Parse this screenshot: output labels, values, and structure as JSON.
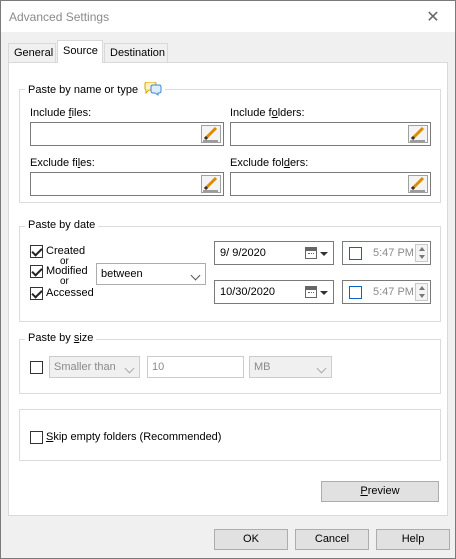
{
  "window": {
    "title": "Advanced Settings",
    "close_glyph": "✕"
  },
  "tabs": [
    {
      "label": "General"
    },
    {
      "label": "Source",
      "active": true
    },
    {
      "label": "Destination"
    }
  ],
  "paste_by_name": {
    "group_label": "Paste by name or type",
    "info_icon": "speech-bubbles-icon",
    "include_files": {
      "label_pre": "Include ",
      "label_key": "f",
      "label_post": "iles:",
      "value": ""
    },
    "include_folders": {
      "label_pre": "Include f",
      "label_key": "o",
      "label_post": "lders:",
      "value": ""
    },
    "exclude_files": {
      "label_pre": "Exclude fi",
      "label_key": "l",
      "label_post": "es:",
      "value": ""
    },
    "exclude_folders": {
      "label_pre": "Exclude fol",
      "label_key": "d",
      "label_post": "ers:",
      "value": ""
    },
    "edit_icon": "pencil-icon"
  },
  "paste_by_date": {
    "group_label": "Paste by date",
    "created": {
      "label": "Created",
      "checked": true
    },
    "or1": "or",
    "modified": {
      "label": "Modified",
      "checked": true
    },
    "or2": "or",
    "accessed": {
      "label": "Accessed",
      "checked": true
    },
    "operator": "between",
    "date_from": "9/  9/2020",
    "date_to": "10/30/2020",
    "time_from": "5:47 PM",
    "time_to": "5:47 PM",
    "time_from_enabled": false,
    "time_to_enabled": false,
    "calendar_icon": "calendar-icon"
  },
  "paste_by_size": {
    "group_label_pre": "Paste by ",
    "group_label_key": "s",
    "group_label_post": "ize",
    "enabled": false,
    "comparison": "Smaller than",
    "value": "10",
    "unit": "MB"
  },
  "options": {
    "skip_empty_pre": "",
    "skip_empty_key": "S",
    "skip_empty_post": "kip empty folders (Recommended)",
    "skip_empty_checked": false
  },
  "preview_button": {
    "key": "P",
    "rest": "review"
  },
  "footer": {
    "ok": "OK",
    "cancel": "Cancel",
    "help": "Help"
  }
}
